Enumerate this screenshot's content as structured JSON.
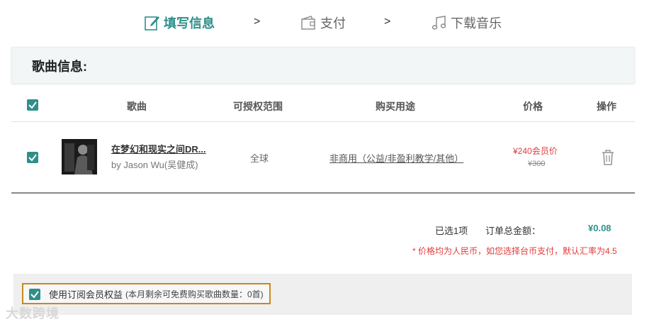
{
  "steps": [
    {
      "label": "填写信息",
      "icon": "edit-icon",
      "active": true
    },
    {
      "label": "支付",
      "icon": "wallet-icon",
      "active": false
    },
    {
      "label": "下载音乐",
      "icon": "music-note-icon",
      "active": false
    }
  ],
  "step_separator": ">",
  "section": {
    "title": "歌曲信息:"
  },
  "table": {
    "headers": {
      "song": "歌曲",
      "scope": "可授权范围",
      "usage": "购买用途",
      "price": "价格",
      "action": "操作"
    },
    "rows": [
      {
        "title": "在梦幻和现实之间DR...",
        "artist": "by Jason Wu(吴健成)",
        "scope": "全球",
        "usage": "非商用（公益/非盈利教学/其他）",
        "member_price": "¥240会员价",
        "original_price": "¥300"
      }
    ]
  },
  "summary": {
    "selected": "已选1项",
    "total_label": "订单总金额：",
    "total_value": "¥0.08",
    "note": "* 价格均为人民币，如您选择台币支付，默认汇率为4.5"
  },
  "member": {
    "label": "使用订阅会员权益",
    "detail": "(本月剩余可免费购买歌曲数量：0首)"
  },
  "watermark": "大数跨境",
  "colors": {
    "accent": "#2f8f8a",
    "price_red": "#e23b3b",
    "highlight_border": "#c8891c"
  }
}
